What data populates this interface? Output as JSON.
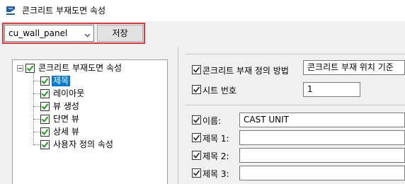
{
  "window": {
    "title": "콘크리트 부재도면 속성"
  },
  "toolbar": {
    "preset_value": "cu_wall_panel",
    "save_label": "저장"
  },
  "tree": {
    "root": {
      "label": "콘크리트 부재도면 속성",
      "checked": true
    },
    "items": [
      {
        "label": "제목",
        "checked": true,
        "selected": true
      },
      {
        "label": "레이아웃",
        "checked": true
      },
      {
        "label": "뷰 생성",
        "checked": true
      },
      {
        "label": "단면 뷰",
        "checked": true
      },
      {
        "label": "상세 뷰",
        "checked": true
      },
      {
        "label": "사용자 정의 속성",
        "checked": true
      }
    ]
  },
  "properties": {
    "definition": {
      "label": "콘크리트 부재 정의 방법",
      "value": "콘크리트 부재 위치 기준",
      "checked": true
    },
    "sheet_number": {
      "label": "시트 번호",
      "value": "1",
      "checked": true
    },
    "name": {
      "label": "이름:",
      "value": "CAST UNIT",
      "checked": true
    },
    "title1": {
      "label": "제목 1:",
      "value": "",
      "checked": true
    },
    "title2": {
      "label": "제목 2:",
      "value": "",
      "checked": true
    },
    "title3": {
      "label": "제목 3:",
      "value": "",
      "checked": true
    }
  },
  "colors": {
    "selection": "#0078d7",
    "check": "#1f9e1f",
    "highlight_frame": "#e0383b"
  }
}
